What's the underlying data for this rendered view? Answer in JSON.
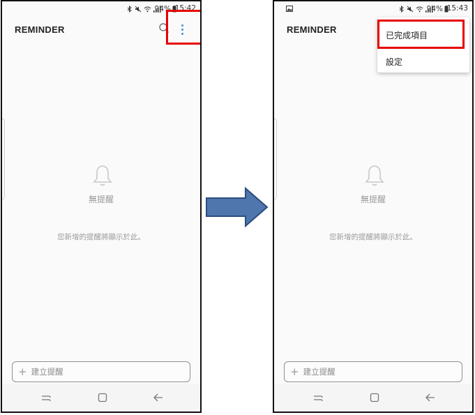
{
  "colors": {
    "highlight": "#e60000",
    "arrow_fill": "#4f76ad",
    "arrow_stroke": "#2d4e7e",
    "accent": "#3e8fd8"
  },
  "left_screen": {
    "status": {
      "battery": "94%",
      "time": "15:42"
    },
    "app_title": "REMINDER",
    "empty_title": "無提醒",
    "empty_hint": "您新增的提醒將顯示於此。",
    "add_placeholder": "建立提醒",
    "icons": [
      "search-icon",
      "more-vertical-icon",
      "bell-icon",
      "plus-icon"
    ]
  },
  "right_screen": {
    "status": {
      "battery": "94%",
      "time": "15:43"
    },
    "app_title": "REMINDER",
    "menu_items": [
      "已完成項目",
      "設定"
    ],
    "empty_title": "無提醒",
    "empty_hint": "您新增的提醒將顯示於此。",
    "add_placeholder": "建立提醒",
    "icons": [
      "gallery-icon",
      "bell-icon",
      "plus-icon"
    ]
  },
  "transition": "arrow-right-icon"
}
